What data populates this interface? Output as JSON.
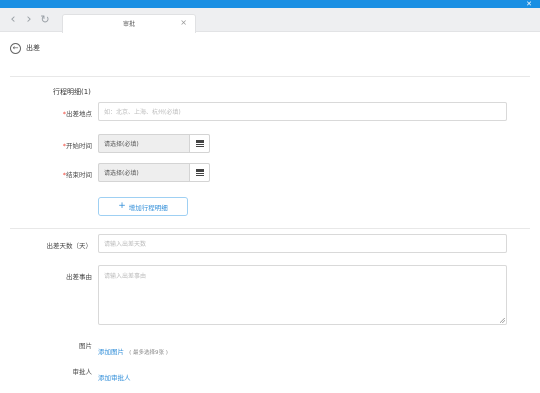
{
  "browser": {
    "tab_title": "审批",
    "tab_close": "×",
    "back_glyph": "‹",
    "forward_glyph": "›",
    "refresh_glyph": "↻",
    "window_close": "✕"
  },
  "header": {
    "back_glyph": "←",
    "title": "出差"
  },
  "itinerary": {
    "section_title": "行程明细(1)",
    "location": {
      "required_mark": "*",
      "label": "出差地点",
      "placeholder": "如：北京、上海、杭州(必填)"
    },
    "start_time": {
      "required_mark": "*",
      "label": "开始时间",
      "value": "请选择(必填)",
      "icon": "calendar-icon"
    },
    "end_time": {
      "required_mark": "*",
      "label": "结束时间",
      "value": "请选择(必填)",
      "icon": "calendar-icon"
    },
    "add_button": {
      "plus": "+",
      "label": "增加行程明细"
    }
  },
  "details": {
    "days": {
      "label": "出差天数（天）",
      "placeholder": "请输入出差天数"
    },
    "reason": {
      "label": "出差事由",
      "placeholder": "请输入出差事由"
    },
    "image": {
      "label": "图片",
      "link": "添加图片",
      "hint": "( 最多选择9张 )"
    },
    "approver": {
      "label": "审批人",
      "link": "添加审批人"
    }
  },
  "colors": {
    "accent": "#2d8cd8",
    "required": "#f04134",
    "top_bar": "#1a8fe3"
  }
}
